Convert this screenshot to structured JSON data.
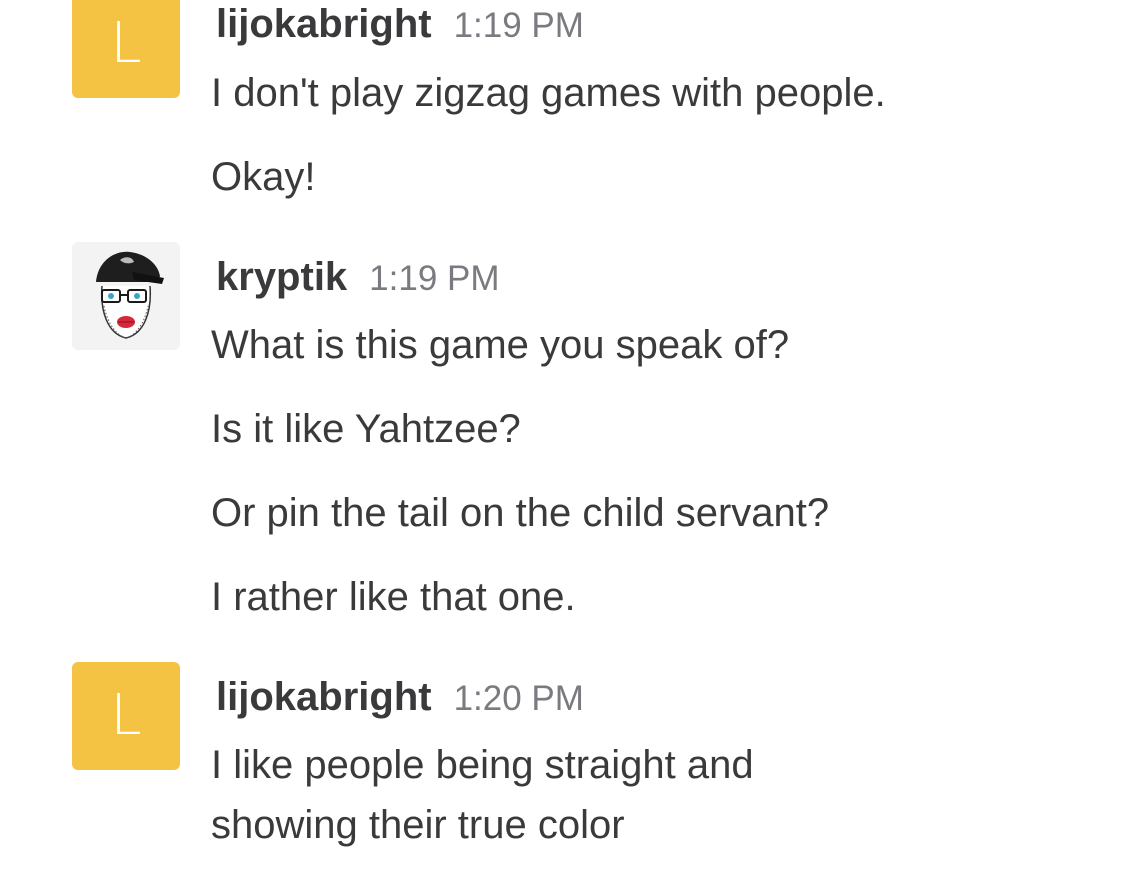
{
  "colors": {
    "avatar_letter_bg": "#f4c344",
    "username": "#3a3a3c",
    "timestamp": "#7a7a80",
    "message_text": "#3a3a3c"
  },
  "messages": [
    {
      "avatar": {
        "type": "letter",
        "letter": "L"
      },
      "username": "lijokabright",
      "time": "1:19 PM",
      "lines": [
        "I don't play zigzag games with people.",
        "Okay!"
      ]
    },
    {
      "avatar": {
        "type": "photo",
        "icon": "hipster-face-avatar-icon"
      },
      "username": "kryptik",
      "time": "1:19 PM",
      "lines": [
        "What is this game you speak of?",
        "Is it like Yahtzee?",
        "Or pin the tail on the child servant?",
        "I rather like that one."
      ]
    },
    {
      "avatar": {
        "type": "letter",
        "letter": "L"
      },
      "username": "lijokabright",
      "time": "1:20 PM",
      "lines": [
        "I like people being straight and",
        "showing their true color"
      ]
    }
  ]
}
